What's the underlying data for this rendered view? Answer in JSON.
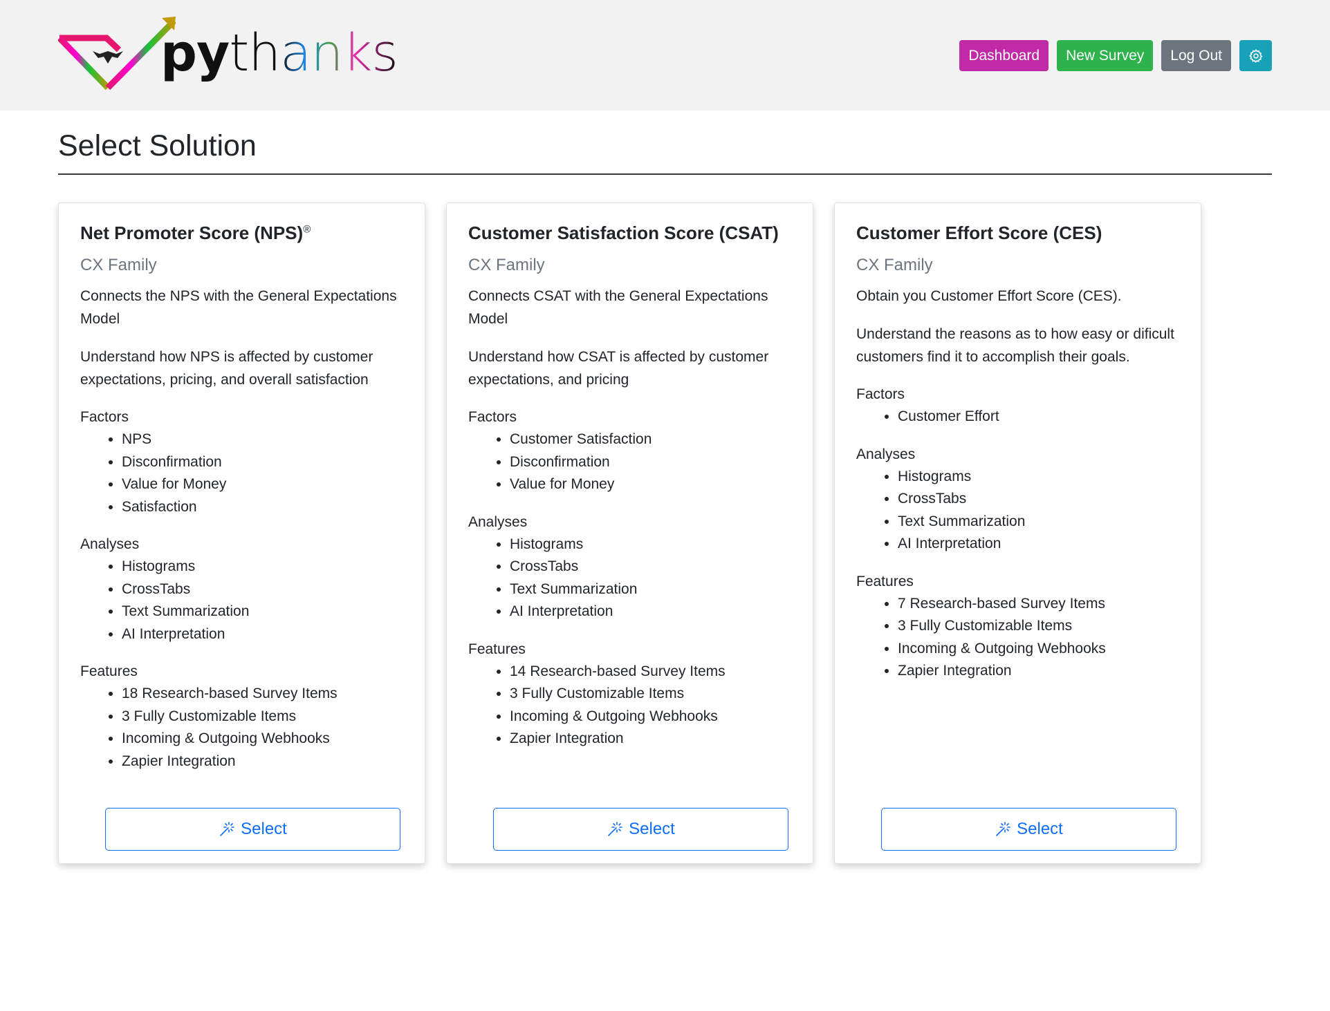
{
  "brand": {
    "py": "py",
    "thanks": "thanks"
  },
  "nav": {
    "dashboard": "Dashboard",
    "new_survey": "New Survey",
    "logout": "Log Out",
    "settings_icon": "gear-icon"
  },
  "colors": {
    "dashboard": "#c02aa7",
    "new_survey": "#2eb24b",
    "logout": "#6c757d",
    "settings": "#17a2b8",
    "accent": "#0d6efd"
  },
  "page": {
    "title": "Select Solution"
  },
  "cards": [
    {
      "title": "Net Promoter Score (NPS)",
      "title_sup": "®",
      "subtitle": "CX Family",
      "desc1": "Connects the NPS with the General Expectations Model",
      "desc2": "Understand how NPS is affected by customer expectations, pricing, and overall satisfaction",
      "factors_label": "Factors",
      "factors": [
        "NPS",
        "Disconfirmation",
        "Value for Money",
        "Satisfaction"
      ],
      "analyses_label": "Analyses",
      "analyses": [
        "Histograms",
        "CrossTabs",
        "Text Summarization",
        "AI Interpretation"
      ],
      "features_label": "Features",
      "features": [
        "18 Research-based Survey Items",
        "3 Fully Customizable Items",
        "Incoming & Outgoing Webhooks",
        "Zapier Integration"
      ],
      "button": "Select"
    },
    {
      "title": "Customer Satisfaction Score (CSAT)",
      "title_sup": "",
      "subtitle": "CX Family",
      "desc1": "Connects CSAT with the General Expectations Model",
      "desc2": "Understand how CSAT is affected by customer expectations, and pricing",
      "factors_label": "Factors",
      "factors": [
        "Customer Satisfaction",
        "Disconfirmation",
        "Value for Money"
      ],
      "analyses_label": "Analyses",
      "analyses": [
        "Histograms",
        "CrossTabs",
        "Text Summarization",
        "AI Interpretation"
      ],
      "features_label": "Features",
      "features": [
        "14 Research-based Survey Items",
        "3 Fully Customizable Items",
        "Incoming & Outgoing Webhooks",
        "Zapier Integration"
      ],
      "button": "Select"
    },
    {
      "title": "Customer Effort Score (CES)",
      "title_sup": "",
      "subtitle": "CX Family",
      "desc1": "Obtain you Customer Effort Score (CES).",
      "desc2": "Understand the reasons as to how easy or dificult customers find it to accomplish their goals.",
      "factors_label": "Factors",
      "factors": [
        "Customer Effort"
      ],
      "analyses_label": "Analyses",
      "analyses": [
        "Histograms",
        "CrossTabs",
        "Text Summarization",
        "AI Interpretation"
      ],
      "features_label": "Features",
      "features": [
        "7 Research-based Survey Items",
        "3 Fully Customizable Items",
        "Incoming & Outgoing Webhooks",
        "Zapier Integration"
      ],
      "button": "Select"
    }
  ]
}
